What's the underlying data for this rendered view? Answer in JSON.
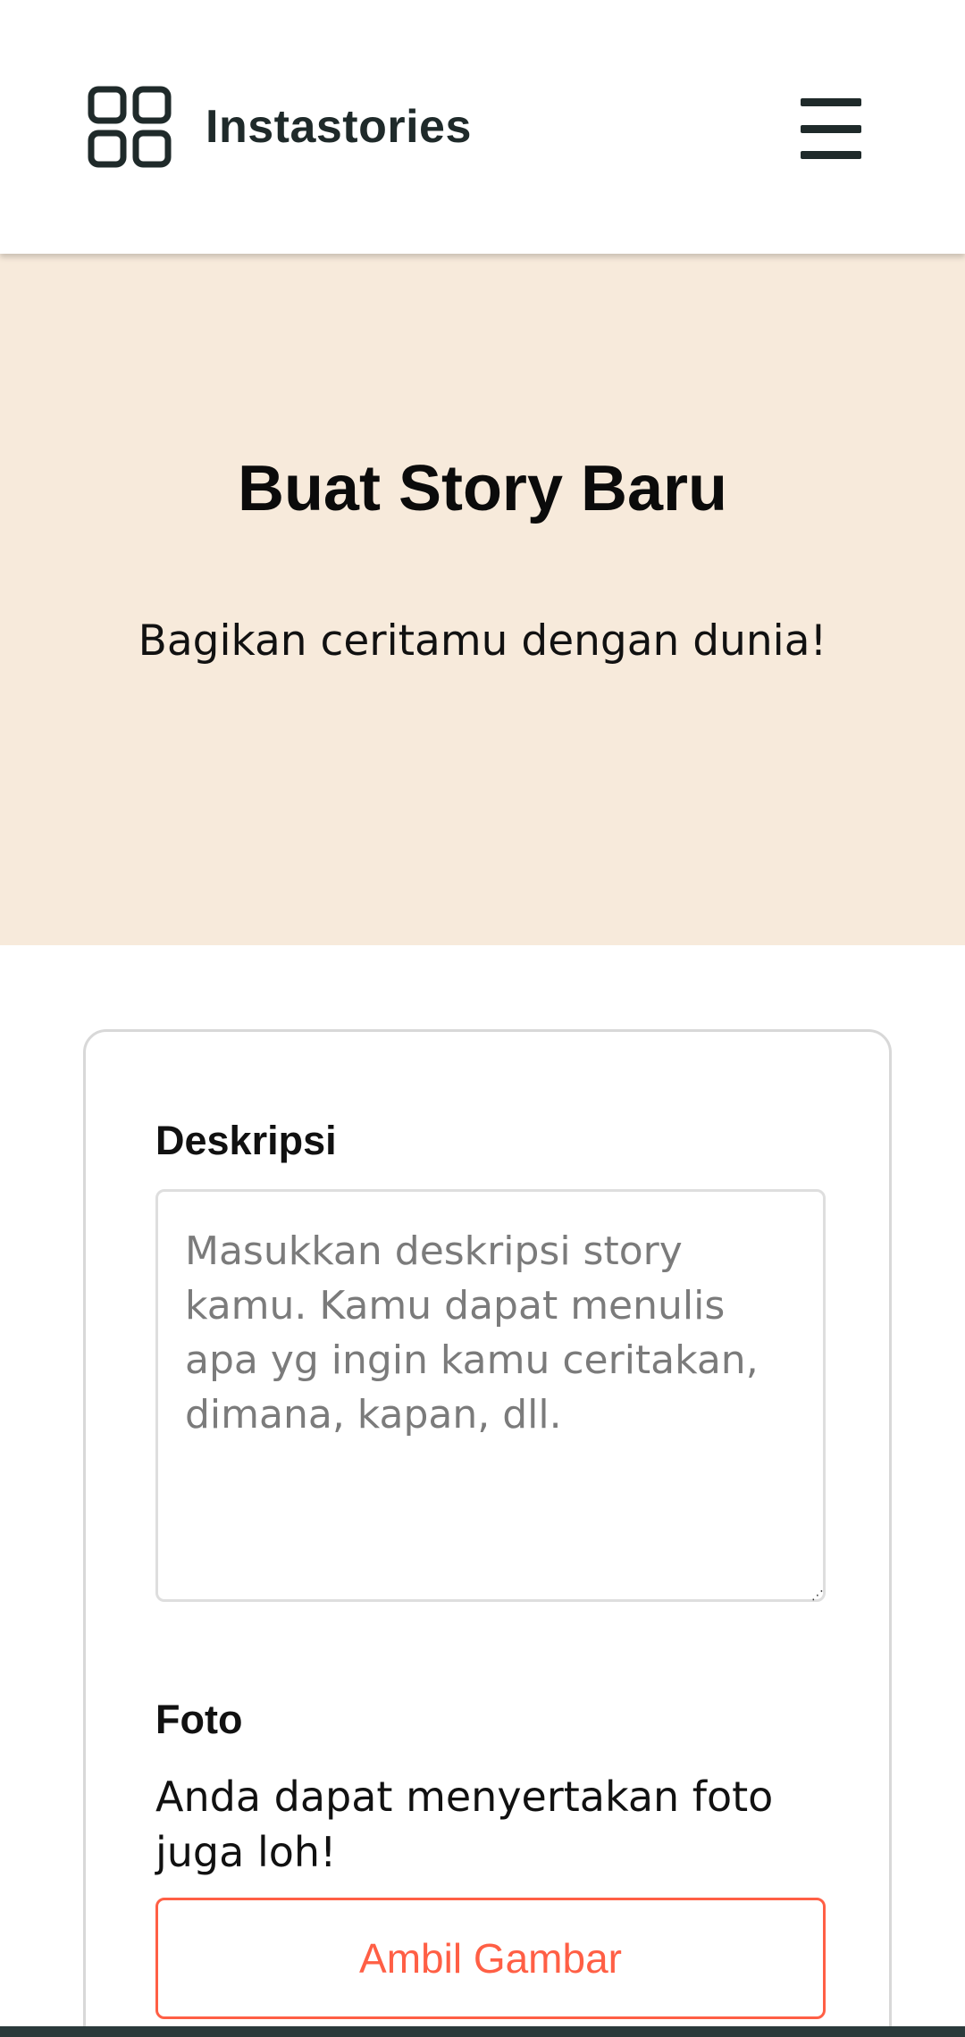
{
  "app": {
    "title": "Instastories",
    "logo_icon": "grid-icon",
    "menu_icon": "hamburger-menu-icon"
  },
  "hero": {
    "title": "Buat Story Baru",
    "subtitle": "Bagikan ceritamu dengan dunia!",
    "background_color": "#f7eadb"
  },
  "form": {
    "description_label": "Deskripsi",
    "description_value": "",
    "description_placeholder": "Masukkan deskripsi story kamu. Kamu dapat menulis apa yg ingin kamu ceritakan, dimana, kapan, dll.",
    "photo_label": "Foto",
    "photo_help": "Anda dapat menyertakan foto juga loh!",
    "take_photo_button": "Ambil Gambar",
    "accent_color": "#ff5f45"
  }
}
